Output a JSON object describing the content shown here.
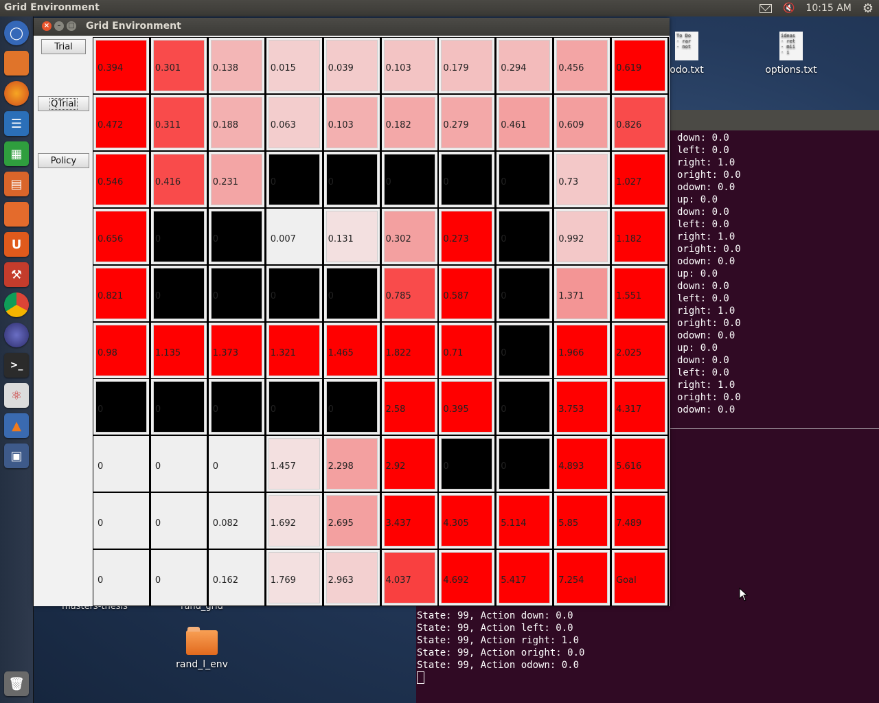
{
  "top_panel": {
    "title": "Grid Environment",
    "time": "10:15 AM",
    "icons": [
      "mail-icon",
      "volume-muted-icon",
      "gear-icon"
    ]
  },
  "launcher": {
    "icons": [
      "ubuntu-dash-icon",
      "files-icon",
      "firefox-icon",
      "writer-icon",
      "calc-icon",
      "impress-icon",
      "software-center-icon",
      "ubuntu-one-icon",
      "settings-icon",
      "chrome-icon",
      "eclipse-icon",
      "terminal-icon",
      "java-icon",
      "matlab-icon",
      "workspace-switcher-icon",
      "trash-icon"
    ]
  },
  "desktop": {
    "icons": [
      {
        "label": "odo.txt"
      },
      {
        "label": "options.txt"
      },
      {
        "label": "rand_l_env"
      }
    ],
    "partial_labels": [
      "masters-thesis",
      "rand_grid"
    ],
    "file_snippets": {
      "todo": "To Do\n- rar\n- not",
      "options": "ideas\n- ret\n- mii\n- i"
    }
  },
  "terminal": {
    "right_lines": [
      "down: 0.0",
      "left: 0.0",
      "right: 1.0",
      "oright: 0.0",
      "odown: 0.0",
      "up: 0.0",
      "down: 0.0",
      "left: 0.0",
      "right: 1.0",
      "oright: 0.0",
      "odown: 0.0",
      "up: 0.0",
      "down: 0.0",
      "left: 0.0",
      "right: 1.0",
      "oright: 0.0",
      "odown: 0.0",
      "up: 0.0",
      "down: 0.0",
      "left: 0.0",
      "right: 1.0",
      "oright: 0.0",
      "odown: 0.0"
    ],
    "bottom_lines": [
      "State: 99, Action down: 0.0",
      "State: 99, Action left: 0.0",
      "State: 99, Action right: 1.0",
      "State: 99, Action oright: 0.0",
      "State: 99, Action odown: 0.0"
    ]
  },
  "window": {
    "title": "Grid Environment",
    "buttons": {
      "trial": "Trial",
      "qtrial": "QTrial",
      "policy": "Policy"
    },
    "grid": [
      [
        "0.394",
        "0.301",
        "0.138",
        "0.015",
        "0.039",
        "0.103",
        "0.179",
        "0.294",
        "0.456",
        "0.619"
      ],
      [
        "0.472",
        "0.311",
        "0.188",
        "0.063",
        "0.103",
        "0.182",
        "0.279",
        "0.461",
        "0.609",
        "0.826"
      ],
      [
        "0.546",
        "0.416",
        "0.231",
        "0",
        "0",
        "0",
        "0",
        "0",
        "0.73",
        "1.027"
      ],
      [
        "0.656",
        "0",
        "0",
        "0.007",
        "0.131",
        "0.302",
        "0.273",
        "0",
        "0.992",
        "1.182"
      ],
      [
        "0.821",
        "0",
        "0",
        "0",
        "0",
        "0.785",
        "0.587",
        "0",
        "1.371",
        "1.551"
      ],
      [
        "0.98",
        "1.135",
        "1.373",
        "1.321",
        "1.465",
        "1.822",
        "0.71",
        "0",
        "1.966",
        "2.025"
      ],
      [
        "0",
        "0",
        "0",
        "0",
        "0",
        "2.58",
        "0.395",
        "0",
        "3.753",
        "4.317"
      ],
      [
        "0",
        "0",
        "0",
        "1.457",
        "2.298",
        "2.92",
        "0",
        "0",
        "4.893",
        "5.616"
      ],
      [
        "0",
        "0",
        "0.082",
        "1.692",
        "2.695",
        "3.437",
        "4.305",
        "5.114",
        "5.85",
        "7.489"
      ],
      [
        "0",
        "0",
        "0.162",
        "1.769",
        "2.963",
        "4.037",
        "4.692",
        "5.417",
        "7.254",
        "Goal"
      ]
    ],
    "cell_colors": [
      [
        "#ff0000",
        "#f94b4b",
        "#f3b6b6",
        "#f3cfcf",
        "#f3cbcb",
        "#f3c4c4",
        "#f3c0c0",
        "#f3bbbb",
        "#f3a5a5",
        "#ff0000"
      ],
      [
        "#ff0000",
        "#f94b4b",
        "#f3b0b0",
        "#f3cdcd",
        "#f3b0b0",
        "#f3a8a8",
        "#f3a8a8",
        "#f3a0a0",
        "#f39e9e",
        "#f94b4b"
      ],
      [
        "#ff0000",
        "#f94b4b",
        "#f3a5a5",
        "#000000",
        "#000000",
        "#000000",
        "#000000",
        "#000000",
        "#f3c8c8",
        "#ff0000"
      ],
      [
        "#ff0000",
        "#000000",
        "#000000",
        "#efefef",
        "#f3e0e0",
        "#f3a0a0",
        "#ff0000",
        "#000000",
        "#f3c8c8",
        "#ff0000"
      ],
      [
        "#ff0000",
        "#000000",
        "#000000",
        "#000000",
        "#000000",
        "#f94b4b",
        "#ff0000",
        "#000000",
        "#f39595",
        "#ff0000"
      ],
      [
        "#ff0000",
        "#ff0000",
        "#ff0000",
        "#ff0000",
        "#ff0000",
        "#ff0000",
        "#ff0000",
        "#000000",
        "#ff0000",
        "#ff0000"
      ],
      [
        "#000000",
        "#000000",
        "#000000",
        "#000000",
        "#000000",
        "#ff0000",
        "#ff0000",
        "#000000",
        "#ff0000",
        "#ff0000"
      ],
      [
        "#efefef",
        "#efefef",
        "#efefef",
        "#f3e0e0",
        "#f3a0a0",
        "#ff0000",
        "#000000",
        "#000000",
        "#ff0000",
        "#ff0000"
      ],
      [
        "#efefef",
        "#efefef",
        "#efefef",
        "#f3e0e0",
        "#f3a0a0",
        "#ff0000",
        "#ff0000",
        "#ff0000",
        "#ff0000",
        "#ff0000"
      ],
      [
        "#efefef",
        "#efefef",
        "#efefef",
        "#f3e0e0",
        "#f3d0d0",
        "#f94040",
        "#ff0000",
        "#ff0000",
        "#ff0000",
        "#ff0000"
      ]
    ]
  }
}
